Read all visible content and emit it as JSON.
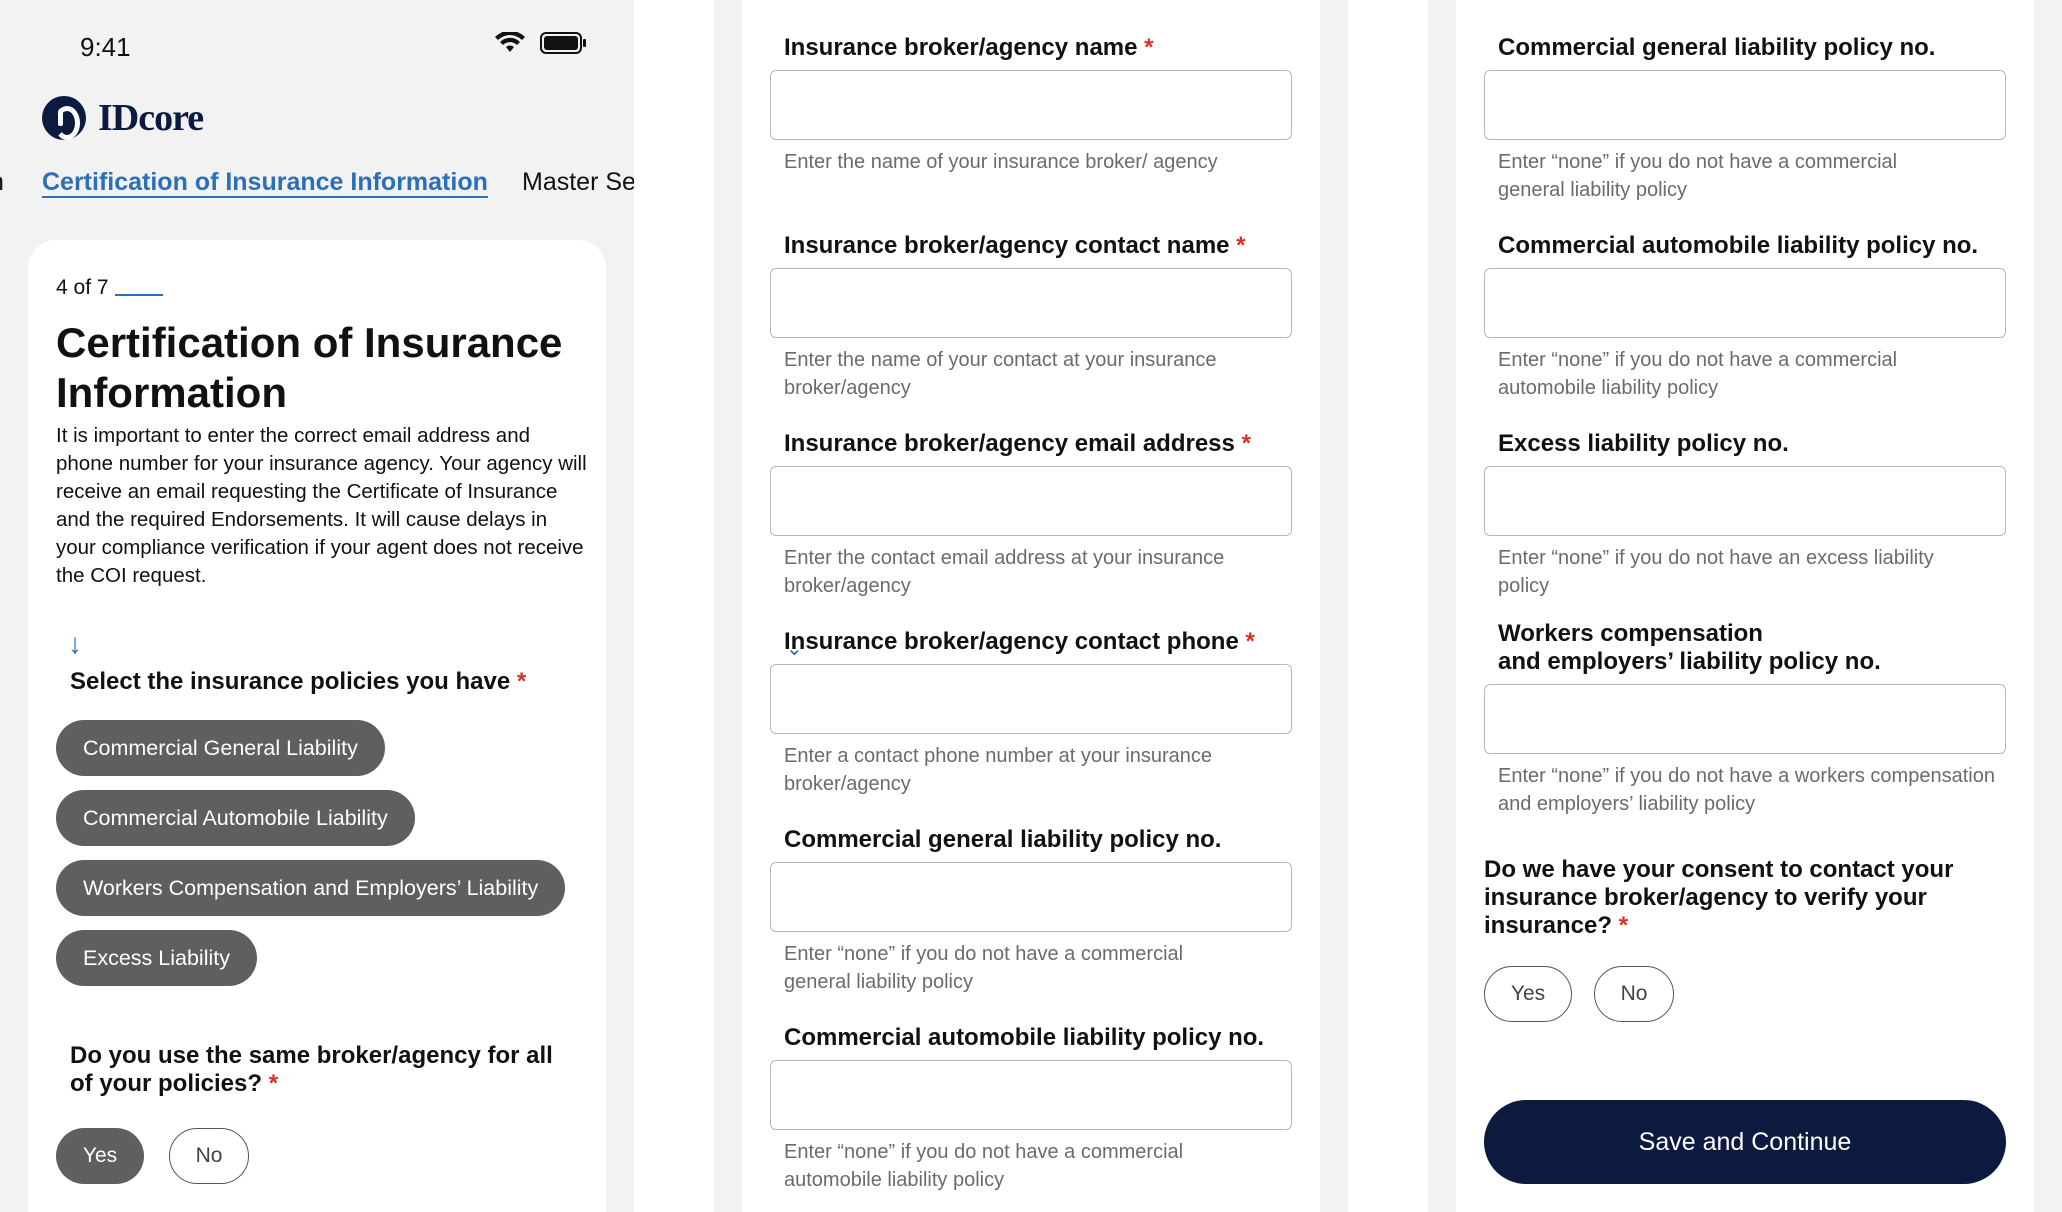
{
  "status_bar": {
    "time": "9:41"
  },
  "logo": {
    "text": "IDcore"
  },
  "tabs": {
    "prev": "n",
    "active": "Certification of Insurance Information",
    "next": "Master Se"
  },
  "step": {
    "label": "4 of 7"
  },
  "page": {
    "title": "Certification of Insurance Information",
    "description": "It is important to enter the correct email address and phone number for your insurance agency. Your agency will receive an email requesting the Certificate of Insurance and the required Endorsements. It will cause delays in your compliance verification if your agent does not receive the COI request."
  },
  "policies_question": {
    "label": "Select the insurance policies you have",
    "required": "*",
    "options": [
      "Commercial General Liability",
      "Commercial Automobile Liability",
      "Workers Compensation and Employers’ Liability",
      "Excess Liability"
    ]
  },
  "same_broker_question": {
    "label": "Do you use the same broker/agency for all of your policies?",
    "required": "*",
    "yes": "Yes",
    "no": "No"
  },
  "form2": {
    "fields": [
      {
        "label": "Insurance broker/agency name",
        "required": "*",
        "help": "Enter the name of your insurance broker/ agency",
        "value": ""
      },
      {
        "label": "Insurance broker/agency contact name",
        "required": "*",
        "help": "Enter the name of your contact at your insurance broker/agency",
        "value": ""
      },
      {
        "label": "Insurance broker/agency email address",
        "required": "*",
        "help": "Enter the contact email address at your insurance broker/agency",
        "value": ""
      },
      {
        "label": "Insurance broker/agency contact phone",
        "required": "*",
        "help": "Enter a contact phone number at your insurance broker/agency",
        "value": ""
      },
      {
        "label": "Commercial general liability policy no.",
        "help": "Enter “none” if you do not have a commercial general liability policy",
        "value": ""
      },
      {
        "label": "Commercial automobile liability policy no.",
        "help": "Enter “none” if you do not have a commercial automobile liability policy",
        "value": ""
      }
    ]
  },
  "form3": {
    "fields": [
      {
        "label": "Commercial general liability policy no.",
        "help": "Enter “none” if you do not have a commercial general liability policy",
        "value": ""
      },
      {
        "label": "Commercial automobile liability policy no.",
        "help": "Enter “none” if you do not have a commercial automobile liability policy",
        "value": ""
      },
      {
        "label": "Excess liability policy no.",
        "help": "Enter “none”  if you do not have an excess liability policy",
        "value": ""
      },
      {
        "label_line1": "Workers compensation",
        "label_line2": "and employers’ liability policy no.",
        "help": "Enter “none”  if you do not have a workers compensation and employers’ liability policy",
        "value": ""
      }
    ],
    "consent_question": {
      "label": "Do we have your consent to contact your insurance broker/agency to verify your insurance?",
      "required": "*",
      "yes": "Yes",
      "no": "No"
    },
    "save_label": "Save and Continue"
  },
  "icons": {
    "wifi": "wifi-icon",
    "battery": "battery-icon",
    "arrow": "arrow-down-icon",
    "logo": "idcore-logo-icon"
  },
  "colors": {
    "brand_navy": "#0d1a3f",
    "link_blue": "#2a6fb8",
    "chip_gray": "#5f5f5f",
    "required_red": "#d93025"
  }
}
